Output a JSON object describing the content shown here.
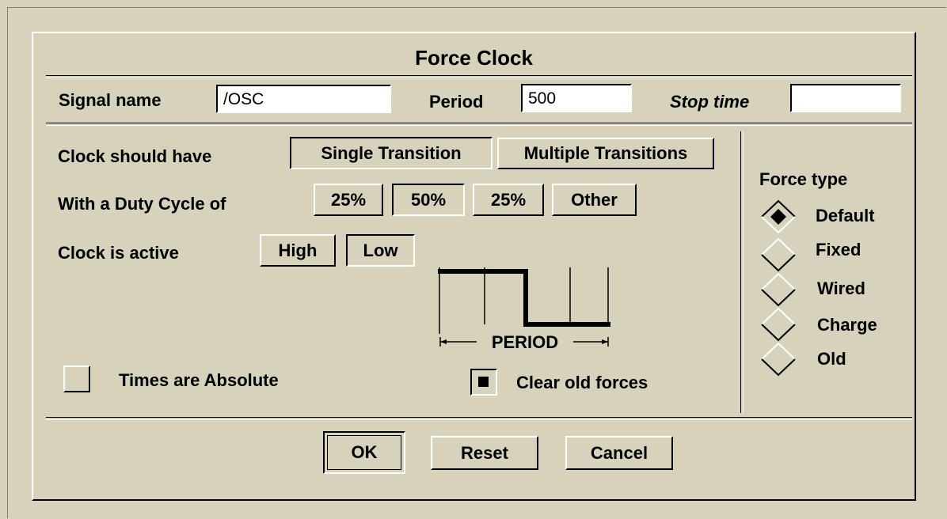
{
  "title": "Force Clock",
  "signal": {
    "name_label": "Signal name",
    "name_value": "/OSC",
    "period_label": "Period",
    "period_value": "500",
    "stop_label": "Stop time",
    "stop_value": ""
  },
  "transitions": {
    "label": "Clock should have",
    "options": [
      "Single Transition",
      "Multiple Transitions"
    ],
    "selected": "Single Transition"
  },
  "duty": {
    "label": "With a Duty Cycle of",
    "options": [
      "25%",
      "50%",
      "25%",
      "Other"
    ],
    "selected": "50%"
  },
  "active": {
    "label": "Clock is active",
    "options": [
      "High",
      "Low"
    ],
    "selected": "Low"
  },
  "diagram": {
    "period_label": "PERIOD"
  },
  "times_absolute": {
    "label": "Times are Absolute",
    "checked": false
  },
  "clear_forces": {
    "label": "Clear old forces",
    "checked": true
  },
  "force_type": {
    "label": "Force type",
    "options": [
      "Default",
      "Fixed",
      "Wired",
      "Charge",
      "Old"
    ],
    "selected": "Default"
  },
  "buttons": {
    "ok": "OK",
    "reset": "Reset",
    "cancel": "Cancel"
  }
}
